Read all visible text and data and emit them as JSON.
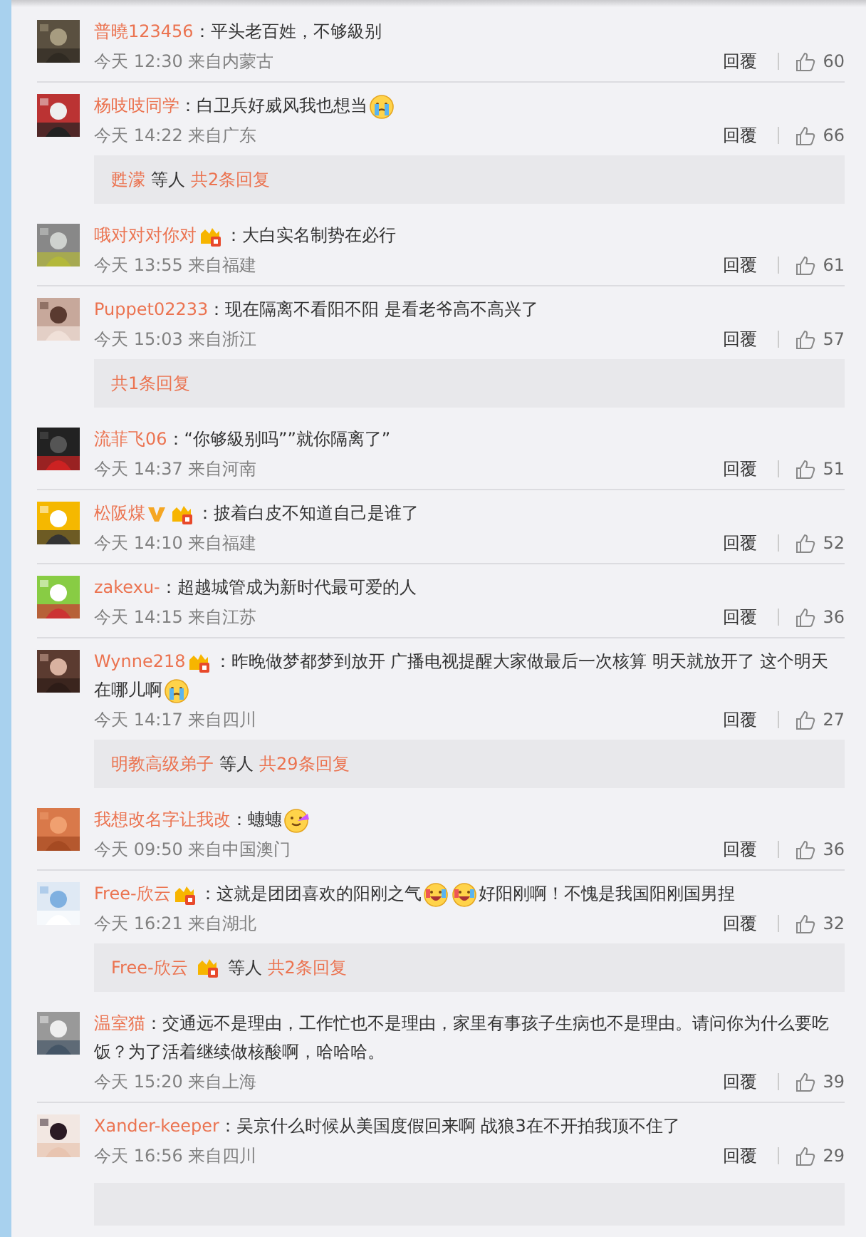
{
  "comments": [
    {
      "user": "普曉123456",
      "content": [
        {
          "kind": "text",
          "text": "：平头老百姓，不够級别"
        }
      ],
      "meta": "今天 12:30 来自内蒙古",
      "reply_label": "回覆",
      "likes": "60"
    },
    {
      "user": "杨吱吱同学",
      "content": [
        {
          "kind": "text",
          "text": "：白卫兵好威风我也想当"
        },
        {
          "kind": "crying_emoji"
        }
      ],
      "meta": "今天 14:22 来自广东",
      "reply_label": "回覆",
      "likes": "66",
      "replies": {
        "users": [
          {
            "name": "甦濛"
          }
        ],
        "suffix": "等人",
        "count": "共2条回复"
      }
    },
    {
      "user": "哦对对对你对",
      "badges": [
        {
          "kind": "member"
        }
      ],
      "content": [
        {
          "kind": "text",
          "text": "：大白实名制势在必行"
        }
      ],
      "meta": "今天 13:55 来自福建",
      "reply_label": "回覆",
      "likes": "61"
    },
    {
      "user": "Puppet02233",
      "content": [
        {
          "kind": "text",
          "text": "：现在隔离不看阳不阳 是看老爷高不高兴了"
        }
      ],
      "meta": "今天 15:03 来自浙江",
      "reply_label": "回覆",
      "likes": "57",
      "replies": {
        "count": "共1条回复"
      }
    },
    {
      "user": "流菲飞06",
      "content": [
        {
          "kind": "text",
          "text": "：“你够級别吗””就你隔离了”"
        }
      ],
      "meta": "今天 14:37 来自河南",
      "reply_label": "回覆",
      "likes": "51"
    },
    {
      "user": "松阪煤",
      "badges": [
        {
          "kind": "verified"
        },
        {
          "kind": "member"
        }
      ],
      "content": [
        {
          "kind": "text",
          "text": "：披着白皮不知道自己是谁了"
        }
      ],
      "meta": "今天 14:10 来自福建",
      "reply_label": "回覆",
      "likes": "52"
    },
    {
      "user": "zakexu-",
      "content": [
        {
          "kind": "text",
          "text": "：超越城管成为新时代最可爱的人"
        }
      ],
      "meta": "今天 14:15 来自江苏",
      "reply_label": "回覆",
      "likes": "36"
    },
    {
      "user": "Wynne218",
      "badges": [
        {
          "kind": "member"
        }
      ],
      "content": [
        {
          "kind": "text",
          "text": "：昨晚做梦都梦到放开 广播电视提醒大家做最后一次核算 明天就放开了 这个明天在哪儿啊"
        },
        {
          "kind": "crying_emoji"
        }
      ],
      "meta": "今天 14:17 来自四川",
      "reply_label": "回覆",
      "likes": "27",
      "replies": {
        "users": [
          {
            "name": "明教高级弟子"
          }
        ],
        "suffix": "等人",
        "count": "共29条回复"
      }
    },
    {
      "user": "我想改名字让我改",
      "content": [
        {
          "kind": "text",
          "text": "：蟪蟪"
        },
        {
          "kind": "rainbow_emoji"
        }
      ],
      "meta": "今天 09:50 来自中国澳门",
      "reply_label": "回覆",
      "likes": "36"
    },
    {
      "user": "Free-欣云",
      "badges": [
        {
          "kind": "member"
        }
      ],
      "content": [
        {
          "kind": "text",
          "text": "：这就是团团喜欢的阳刚之气"
        },
        {
          "kind": "laughing_emoji"
        },
        {
          "kind": "laughing_emoji"
        },
        {
          "kind": "text",
          "text": "好阳刚啊！不愧是我国阳刚国男捏"
        }
      ],
      "meta": "今天 16:21 来自湖北",
      "reply_label": "回覆",
      "likes": "32",
      "replies": {
        "users": [
          {
            "name": "Free-欣云",
            "badges": [
              {
                "kind": "member"
              }
            ]
          }
        ],
        "suffix": "等人",
        "count": "共2条回复"
      }
    },
    {
      "user": "温室猫",
      "content": [
        {
          "kind": "text",
          "text": "：交通远不是理由，工作忙也不是理由，家里有事孩子生病也不是理由。请问你为什么要吃饭？为了活着继续做核酸啊，哈哈哈。"
        }
      ],
      "meta": "今天 15:20 来自上海",
      "reply_label": "回覆",
      "likes": "39"
    },
    {
      "user": "Xander-keeper",
      "content": [
        {
          "kind": "text",
          "text": "：吴京什么时候从美国度假回来啊 战狼3在不开拍我顶不住了"
        }
      ],
      "meta": "今天 16:56 来自四川",
      "reply_label": "回覆",
      "likes": "29"
    }
  ],
  "trailing_reply_panel": true
}
